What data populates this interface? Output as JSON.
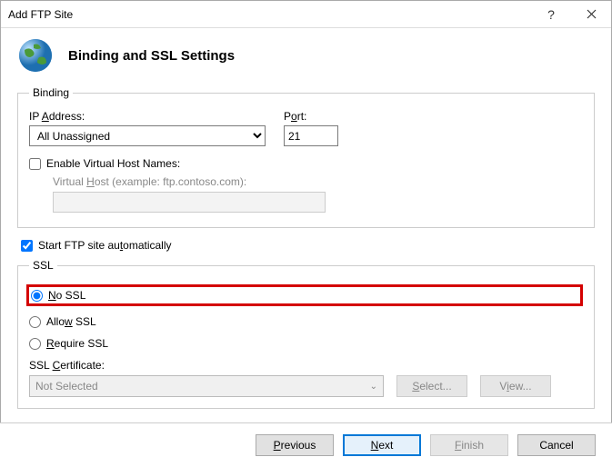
{
  "window": {
    "title": "Add FTP Site"
  },
  "header": {
    "title": "Binding and SSL Settings"
  },
  "binding": {
    "legend": "Binding",
    "ip_label": "IP Address:",
    "ip_label_ul": "A",
    "ip_selected": "All Unassigned",
    "port_label": "Port:",
    "port_label_ul": "o",
    "port_value": "21",
    "vhost_enable_label": "Enable Virtual Host Names:",
    "vhost_enable_checked": false,
    "vhost_label": "Virtual Host (example: ftp.contoso.com):",
    "vhost_label_ul": "H",
    "vhost_value": ""
  },
  "auto_start": {
    "label": "Start FTP site automatically",
    "label_ul": "t",
    "checked": true
  },
  "ssl": {
    "legend": "SSL",
    "options": [
      {
        "label": "No SSL",
        "ul": "N",
        "selected": true
      },
      {
        "label": "Allow SSL",
        "ul": "w",
        "selected": false
      },
      {
        "label": "Require SSL",
        "ul": "R",
        "selected": false
      }
    ],
    "cert_label": "SSL Certificate:",
    "cert_label_ul": "C",
    "cert_selected": "Not Selected",
    "select_btn": "Select...",
    "select_btn_ul": "S",
    "view_btn": "View...",
    "view_btn_ul": "I"
  },
  "footer": {
    "previous": "revious",
    "previous_ul": "P",
    "next": "ext",
    "next_ul": "N",
    "finish": "inish",
    "finish_ul": "F",
    "cancel": "Cancel"
  }
}
